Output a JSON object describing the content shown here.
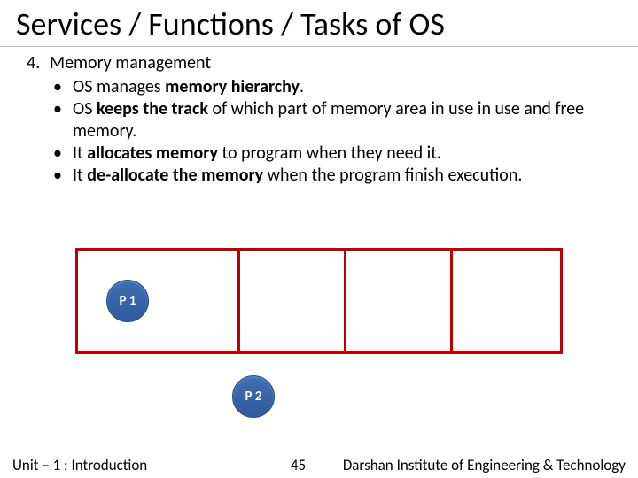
{
  "title": "Services / Functions / Tasks of OS",
  "list": {
    "number": "4.",
    "heading": "Memory management",
    "bullets": {
      "b1_pre": "OS manages ",
      "b1_bold": "memory hierarchy",
      "b1_post": ".",
      "b2_pre": "OS ",
      "b2_bold": "keeps the track",
      "b2_post": " of which part of memory area in use in use and free memory.",
      "b3_pre": "It ",
      "b3_bold": "allocates memory",
      "b3_post": " to program when they need it.",
      "b4_pre": "It ",
      "b4_bold": "de-allocate the memory",
      "b4_post": " when the program finish execution."
    }
  },
  "processes": {
    "p1": "P 1",
    "p2": "P 2"
  },
  "footer": {
    "left": "Unit – 1 : Introduction",
    "page": "45",
    "right": "Darshan Institute of Engineering & Technology"
  }
}
